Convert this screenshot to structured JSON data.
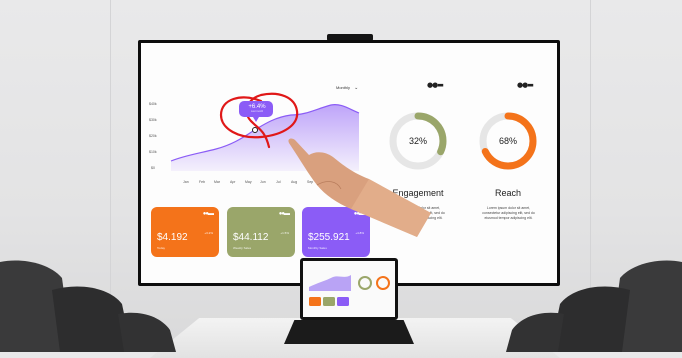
{
  "dashboard": {
    "dropdown_label": "Monthly",
    "callout": {
      "value": "+6.4%",
      "sub": "Last month"
    },
    "y_ticks": [
      "$40k",
      "$30k",
      "$20k",
      "$10k",
      "$0"
    ],
    "x_ticks": [
      "Jan",
      "Feb",
      "Mar",
      "Apr",
      "May",
      "Jun",
      "Jul",
      "Aug",
      "Sep",
      "Oct"
    ],
    "cards": [
      {
        "value": "$4.192",
        "label": "Today",
        "change": "+3.2%",
        "color": "#f4731a"
      },
      {
        "value": "$44.112",
        "label": "Weekly Sales",
        "change": "+1.5%",
        "color": "#9aa66a"
      },
      {
        "value": "$255.921",
        "label": "Monthly Sales",
        "change": "+4.8%",
        "color": "#8b5cf6"
      }
    ],
    "donuts": [
      {
        "percent": "32%",
        "fraction": 0.32,
        "title": "Engagement",
        "color": "#9aa66a",
        "text": "Lorem ipsum dolor sit amet, consectetur adipiscing elit, sed do eiusmod tempor adipiscing elit."
      },
      {
        "percent": "68%",
        "fraction": 0.68,
        "title": "Reach",
        "color": "#f4731a",
        "text": "Lorem ipsum dolor sit amet, consectetur adipiscing elit, sed do eiusmod tempor adipiscing elit."
      }
    ]
  },
  "colors": {
    "purple": "#8b5cf6",
    "annotation": "#e01818",
    "track": "#e6e6e6"
  }
}
